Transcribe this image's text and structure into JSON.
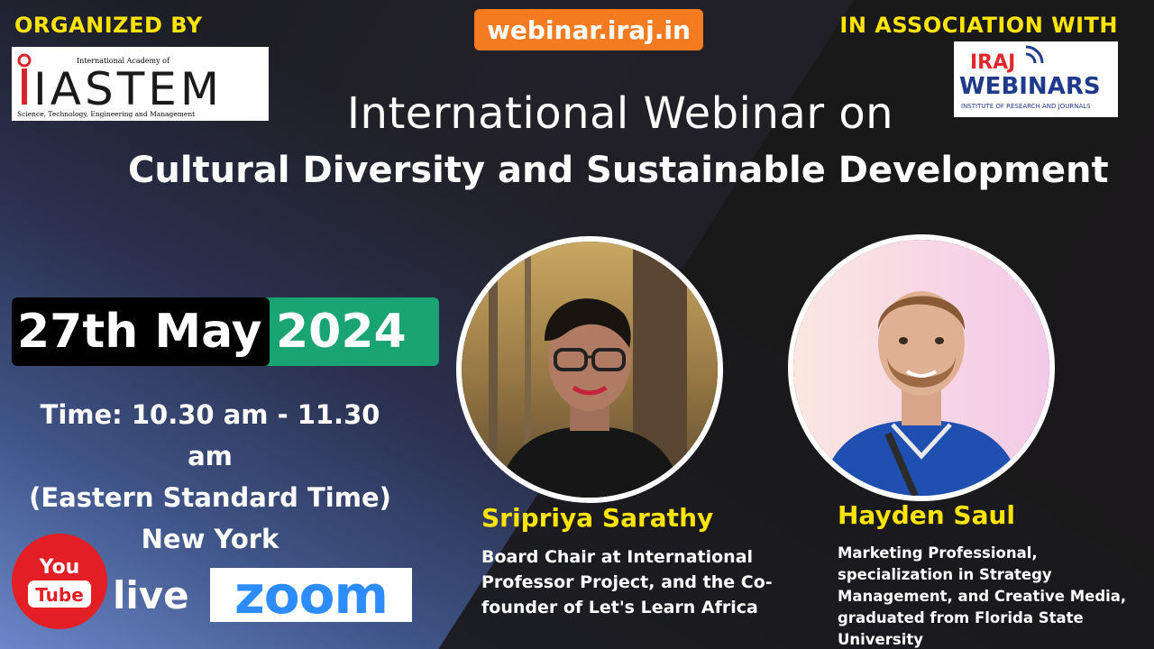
{
  "header": {
    "organized_by": "ORGANIZED BY",
    "association": "IN ASSOCIATION WITH",
    "site": "webinar.iraj.in"
  },
  "logos": {
    "iastem": {
      "small_text": "International Academy of",
      "name": "IASTEM",
      "tagline": "Science, Technology, Engineering and Management"
    },
    "iraj": {
      "line1": "IRAJ",
      "line2": "WEBINARS",
      "tagline": "INSTITUTE OF RESEARCH AND JOURNALS"
    }
  },
  "event": {
    "title_line1": "International Webinar on",
    "title_line2": "Cultural Diversity and Sustainable Development",
    "date_day_month": "27th May",
    "date_year": "2024",
    "time_line1": "Time:  10.30 am - 11.30 am",
    "time_line2": "(Eastern Standard Time)",
    "time_line3": "New York"
  },
  "platforms": {
    "youtube_top": "You",
    "youtube_bottom": "Tube",
    "live": "live",
    "zoom": "zoom"
  },
  "speakers": [
    {
      "name": "Sripriya Sarathy",
      "bio": "Board Chair at International Professor Project, and the Co-founder of Let's Learn Africa"
    },
    {
      "name": "Hayden Saul",
      "bio": "Marketing Professional, specialization in Strategy Management, and Creative Media, graduated from Florida State University"
    }
  ],
  "colors": {
    "accent_yellow": "#ffe400",
    "badge_orange": "#f47b20",
    "date_green": "#1aa474",
    "iastem_red": "#d7262b",
    "iraj_blue": "#1f3a8a",
    "youtube_red": "#e31e24",
    "zoom_blue": "#2d8cff"
  }
}
